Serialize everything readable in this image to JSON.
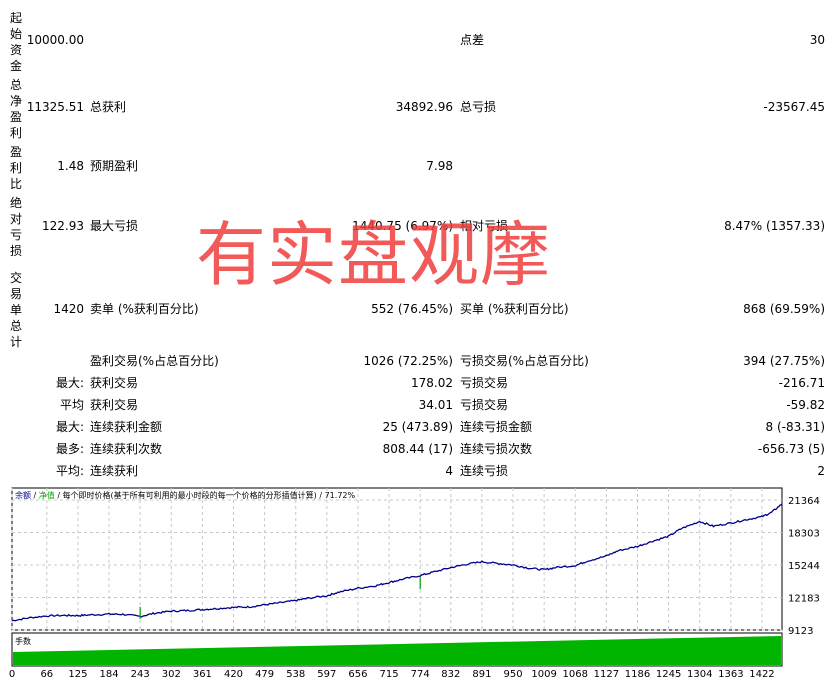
{
  "report": {
    "rows": [
      {
        "vlabel": "起始资金",
        "value": "10000.00",
        "k1": "",
        "v1": "",
        "k2": "点差",
        "v2": "30"
      },
      {
        "vlabel": "总净盈利",
        "value": "11325.51",
        "k1": "总获利",
        "v1": "34892.96",
        "k2": "总亏损",
        "v2": "-23567.45"
      },
      {
        "vlabel": "盈利比",
        "value": "1.48",
        "k1": "预期盈利",
        "v1": "7.98",
        "k2": "",
        "v2": ""
      },
      {
        "vlabel": "绝对亏损",
        "value": "122.93",
        "k1": "最大亏损",
        "v1": "1440.75 (6.97%)",
        "k2": "相对亏损",
        "v2": "8.47% (1357.33)"
      },
      {
        "vlabel": "交易单总计",
        "value": "1420",
        "k1": "卖单 (%获利百分比)",
        "v1": "552 (76.45%)",
        "k2": "买单 (%获利百分比)",
        "v2": "868 (69.59%)"
      }
    ],
    "stats": [
      {
        "prefix": "",
        "k1": "盈利交易(%占总百分比)",
        "v1": "1026 (72.25%)",
        "k2": "亏损交易(%占总百分比)",
        "v2": "394 (27.75%)"
      },
      {
        "prefix": "最大:",
        "k1": "获利交易",
        "v1": "178.02",
        "k2": "亏损交易",
        "v2": "-216.71"
      },
      {
        "prefix": "平均",
        "k1": "获利交易",
        "v1": "34.01",
        "k2": "亏损交易",
        "v2": "-59.82"
      },
      {
        "prefix": "最大:",
        "k1": "连续获利金额",
        "v1": "25 (473.89)",
        "k2": "连续亏损金额",
        "v2": "8 (-83.31)"
      },
      {
        "prefix": "最多:",
        "k1": "连续获利次数",
        "v1": "808.44 (17)",
        "k2": "连续亏损次数",
        "v2": "-656.73 (5)"
      },
      {
        "prefix": "平均:",
        "k1": "连续获利",
        "v1": "4",
        "k2": "连续亏损",
        "v2": "2"
      }
    ]
  },
  "watermark": "有实盘观摩",
  "chart_data": {
    "type": "line",
    "legend": {
      "balance": "余额",
      "equity": "净值",
      "note": "每个即时价格(基于所有可利用的最小时段的每一个价格的分形插值计算)",
      "quality": "71.72%"
    },
    "lot_label": "手数",
    "colors": {
      "balance": "#00008b",
      "equity": "#00a000",
      "volume": "#00b400",
      "grid": "#c8c8c8"
    },
    "ylim": [
      9123,
      22500
    ],
    "yticks": [
      "21364",
      "18303",
      "15244",
      "12183",
      "9123"
    ],
    "xticks": [
      "0",
      "66",
      "125",
      "184",
      "243",
      "302",
      "361",
      "420",
      "479",
      "538",
      "597",
      "656",
      "715",
      "774",
      "832",
      "891",
      "950",
      "1009",
      "1068",
      "1127",
      "1186",
      "1245",
      "1304",
      "1363",
      "1422"
    ],
    "xlim": [
      0,
      1460
    ],
    "balance": {
      "x": [
        0,
        30,
        66,
        100,
        125,
        150,
        184,
        210,
        243,
        270,
        302,
        330,
        361,
        390,
        420,
        450,
        479,
        510,
        538,
        560,
        597,
        620,
        656,
        690,
        715,
        740,
        774,
        800,
        832,
        860,
        891,
        920,
        950,
        980,
        1009,
        1030,
        1068,
        1090,
        1127,
        1150,
        1186,
        1215,
        1245,
        1270,
        1304,
        1330,
        1363,
        1390,
        1422,
        1440,
        1460
      ],
      "y": [
        10000,
        10250,
        10450,
        10500,
        10480,
        10550,
        10620,
        10600,
        10400,
        10700,
        10900,
        10950,
        11050,
        11150,
        11250,
        11300,
        11500,
        11700,
        11900,
        12100,
        12350,
        12700,
        13050,
        13300,
        13600,
        13900,
        14250,
        14600,
        15000,
        15300,
        15550,
        15400,
        15250,
        14950,
        14800,
        15000,
        15200,
        15600,
        16100,
        16600,
        17000,
        17500,
        17950,
        18700,
        19350,
        18900,
        19200,
        19500,
        19800,
        20200,
        21000
      ]
    },
    "equity_spikes": [
      {
        "x": 243,
        "y": 11300
      },
      {
        "x": 774,
        "y": 14100
      }
    ]
  }
}
